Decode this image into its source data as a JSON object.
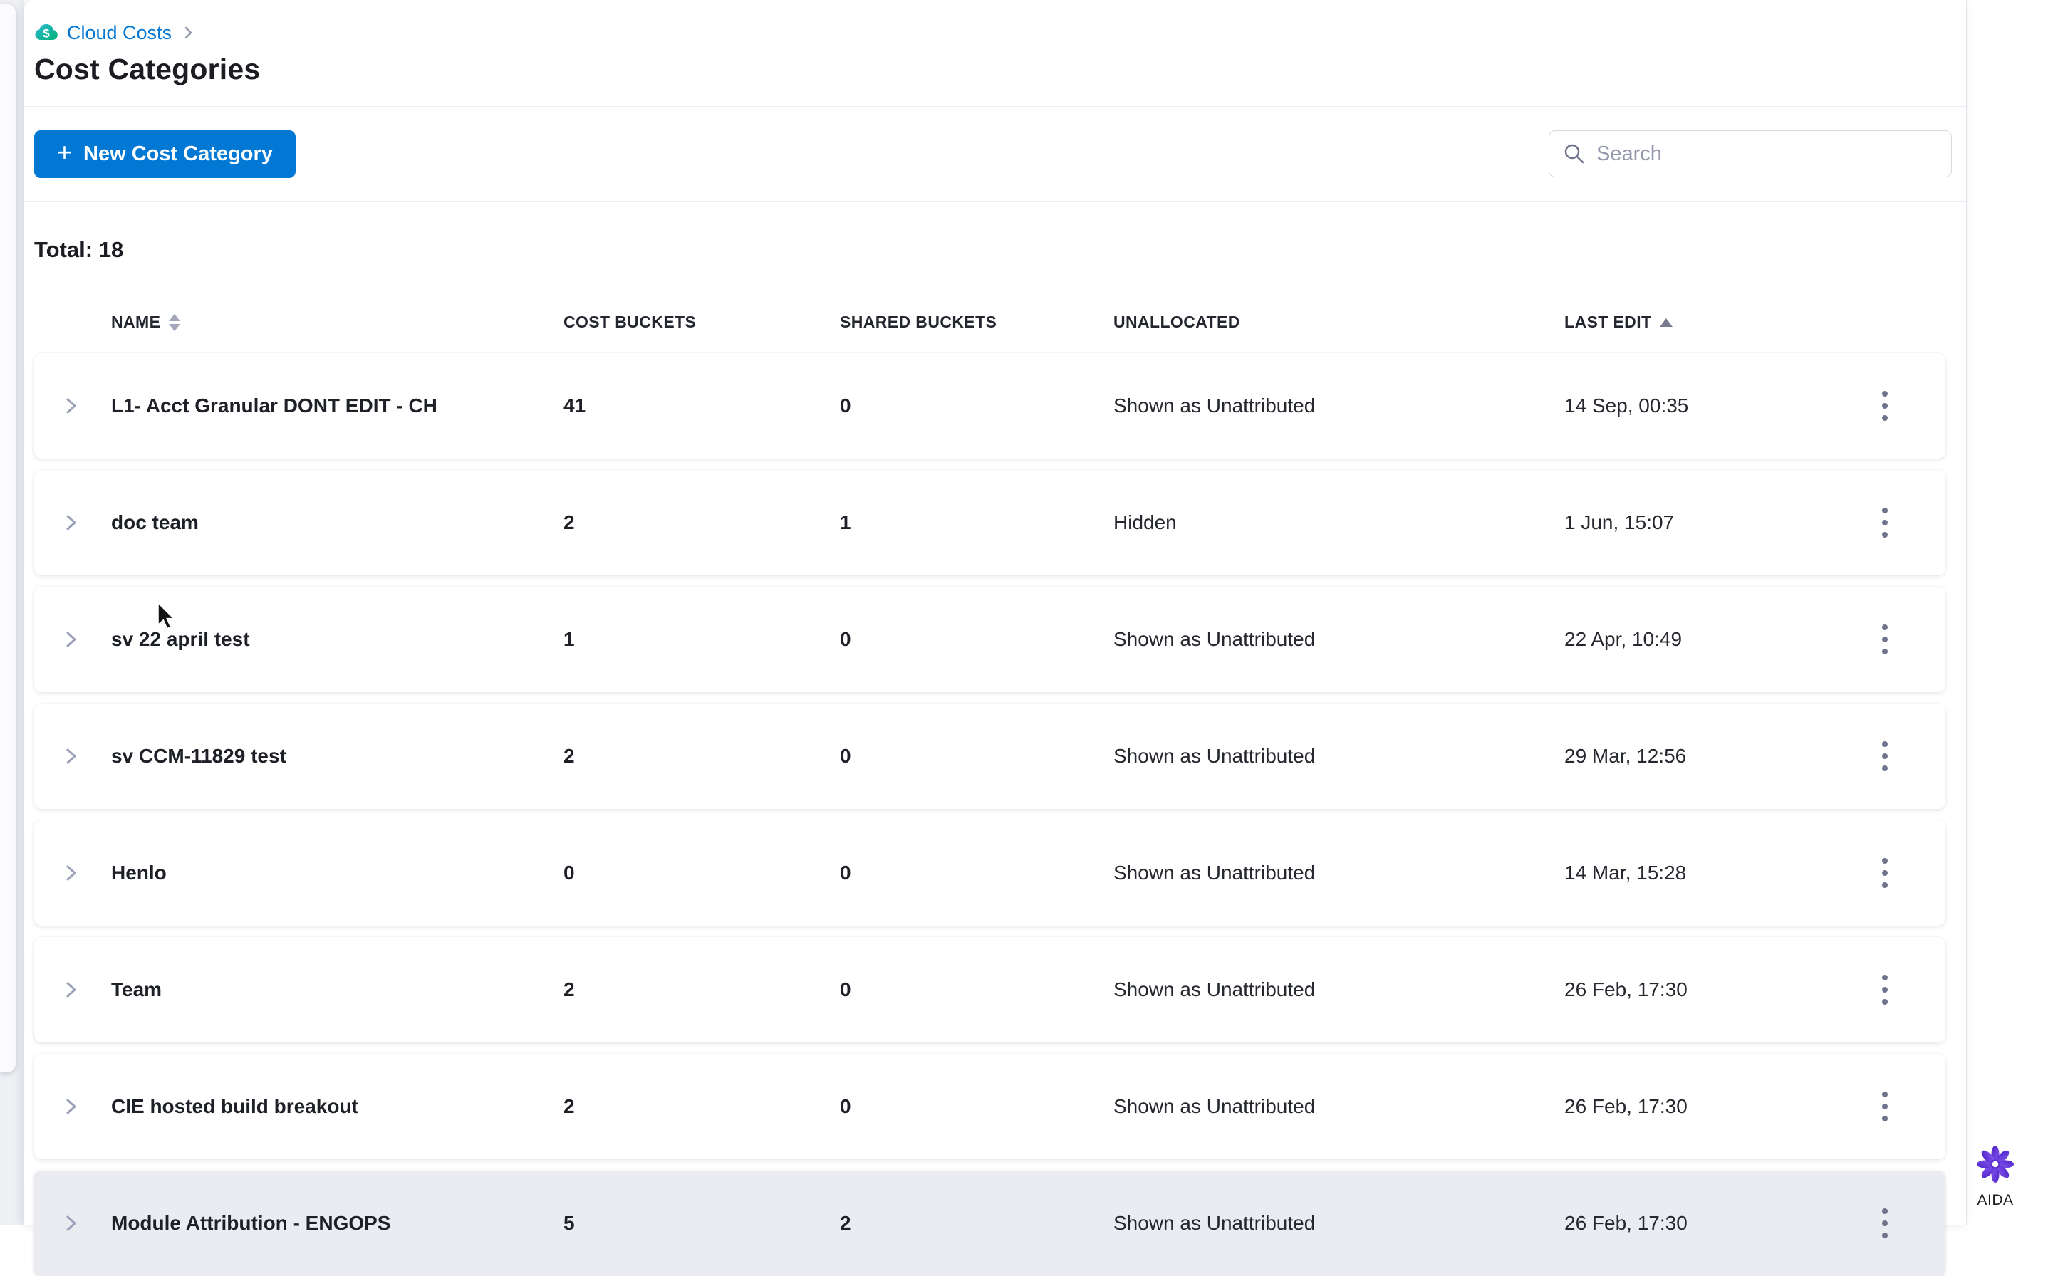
{
  "colors": {
    "accent_blue": "#0278d5",
    "link_blue": "#0278d5",
    "cloud_icon_teal": "#2bb8d2",
    "cloud_icon_green": "#01b277",
    "aida_purple": "#6d3bdc",
    "muted_gray": "#9297ab"
  },
  "breadcrumb": {
    "module_label": "Cloud Costs",
    "separator": "›"
  },
  "page": {
    "title": "Cost Categories",
    "total_label": "Total:",
    "total_value": "18"
  },
  "toolbar": {
    "new_button_plus": "+",
    "new_button_label": "New Cost Category",
    "search_placeholder": "Search",
    "search_value": ""
  },
  "table": {
    "columns": [
      {
        "label": "NAME",
        "sort": "both"
      },
      {
        "label": "COST BUCKETS",
        "sort": "none"
      },
      {
        "label": "SHARED BUCKETS",
        "sort": "none"
      },
      {
        "label": "UNALLOCATED",
        "sort": "none"
      },
      {
        "label": "LAST EDIT",
        "sort": "asc"
      }
    ],
    "rows": [
      {
        "name": "L1- Acct Granular DONT EDIT - CH",
        "cost_buckets": "41",
        "shared_buckets": "0",
        "unallocated": "Shown as Unattributed",
        "last_edit": "14 Sep, 00:35"
      },
      {
        "name": "doc team",
        "cost_buckets": "2",
        "shared_buckets": "1",
        "unallocated": "Hidden",
        "last_edit": "1 Jun, 15:07"
      },
      {
        "name": "sv 22 april test",
        "cost_buckets": "1",
        "shared_buckets": "0",
        "unallocated": "Shown as Unattributed",
        "last_edit": "22 Apr, 10:49"
      },
      {
        "name": "sv CCM-11829 test",
        "cost_buckets": "2",
        "shared_buckets": "0",
        "unallocated": "Shown as Unattributed",
        "last_edit": "29 Mar, 12:56"
      },
      {
        "name": "Henlo",
        "cost_buckets": "0",
        "shared_buckets": "0",
        "unallocated": "Shown as Unattributed",
        "last_edit": "14 Mar, 15:28"
      },
      {
        "name": "Team",
        "cost_buckets": "2",
        "shared_buckets": "0",
        "unallocated": "Shown as Unattributed",
        "last_edit": "26 Feb, 17:30"
      },
      {
        "name": "CIE hosted build breakout",
        "cost_buckets": "2",
        "shared_buckets": "0",
        "unallocated": "Shown as Unattributed",
        "last_edit": "26 Feb, 17:30"
      },
      {
        "name": "Module Attribution - ENGOPS",
        "cost_buckets": "5",
        "shared_buckets": "2",
        "unallocated": "Shown as Unattributed",
        "last_edit": "26 Feb, 17:30",
        "partial": true
      }
    ]
  },
  "aida": {
    "label": "AIDA"
  }
}
